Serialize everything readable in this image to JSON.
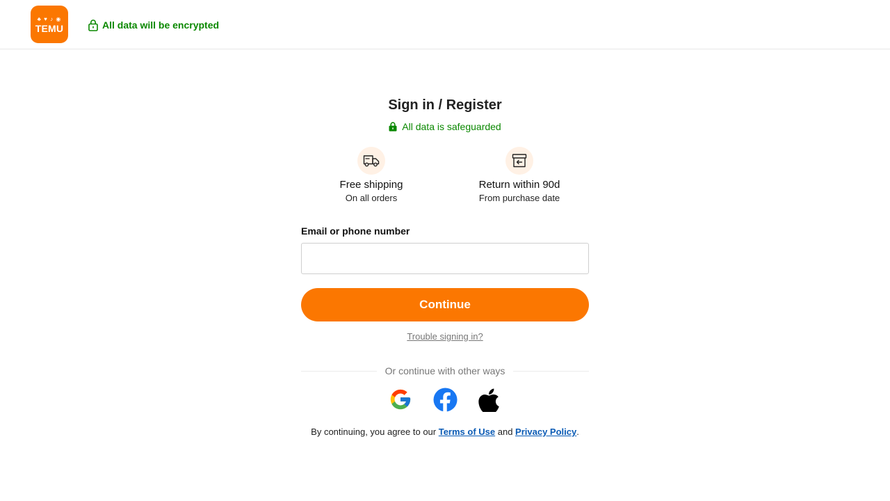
{
  "header": {
    "logo_glyphs": "♣ ♥ ♪ ◉",
    "logo_text": "TEMU",
    "encrypted_text": "All data will be encrypted",
    "encrypted_icon": "lock-icon"
  },
  "main": {
    "title": "Sign in / Register",
    "safeguard_text": "All data is safeguarded",
    "safeguard_icon": "lock-filled-icon",
    "benefits": [
      {
        "icon": "truck-icon",
        "title": "Free shipping",
        "subtitle": "On all orders"
      },
      {
        "icon": "return-box-icon",
        "title": "Return within 90d",
        "subtitle": "From purchase date"
      }
    ],
    "email_label": "Email or phone number",
    "email_value": "",
    "continue_label": "Continue",
    "trouble_link": "Trouble signing in?",
    "divider_text": "Or continue with other ways",
    "social": [
      {
        "icon": "google-icon"
      },
      {
        "icon": "facebook-icon"
      },
      {
        "icon": "apple-icon"
      }
    ],
    "legal": {
      "prefix": "By continuing, you agree to our ",
      "terms": "Terms of Use",
      "and": " and ",
      "privacy": "Privacy Policy",
      "suffix": "."
    }
  },
  "colors": {
    "brand_orange": "#fb7701",
    "secure_green": "#0a8800",
    "link_blue": "#0a5bb5",
    "benefit_circle_bg": "#fff1e5"
  }
}
